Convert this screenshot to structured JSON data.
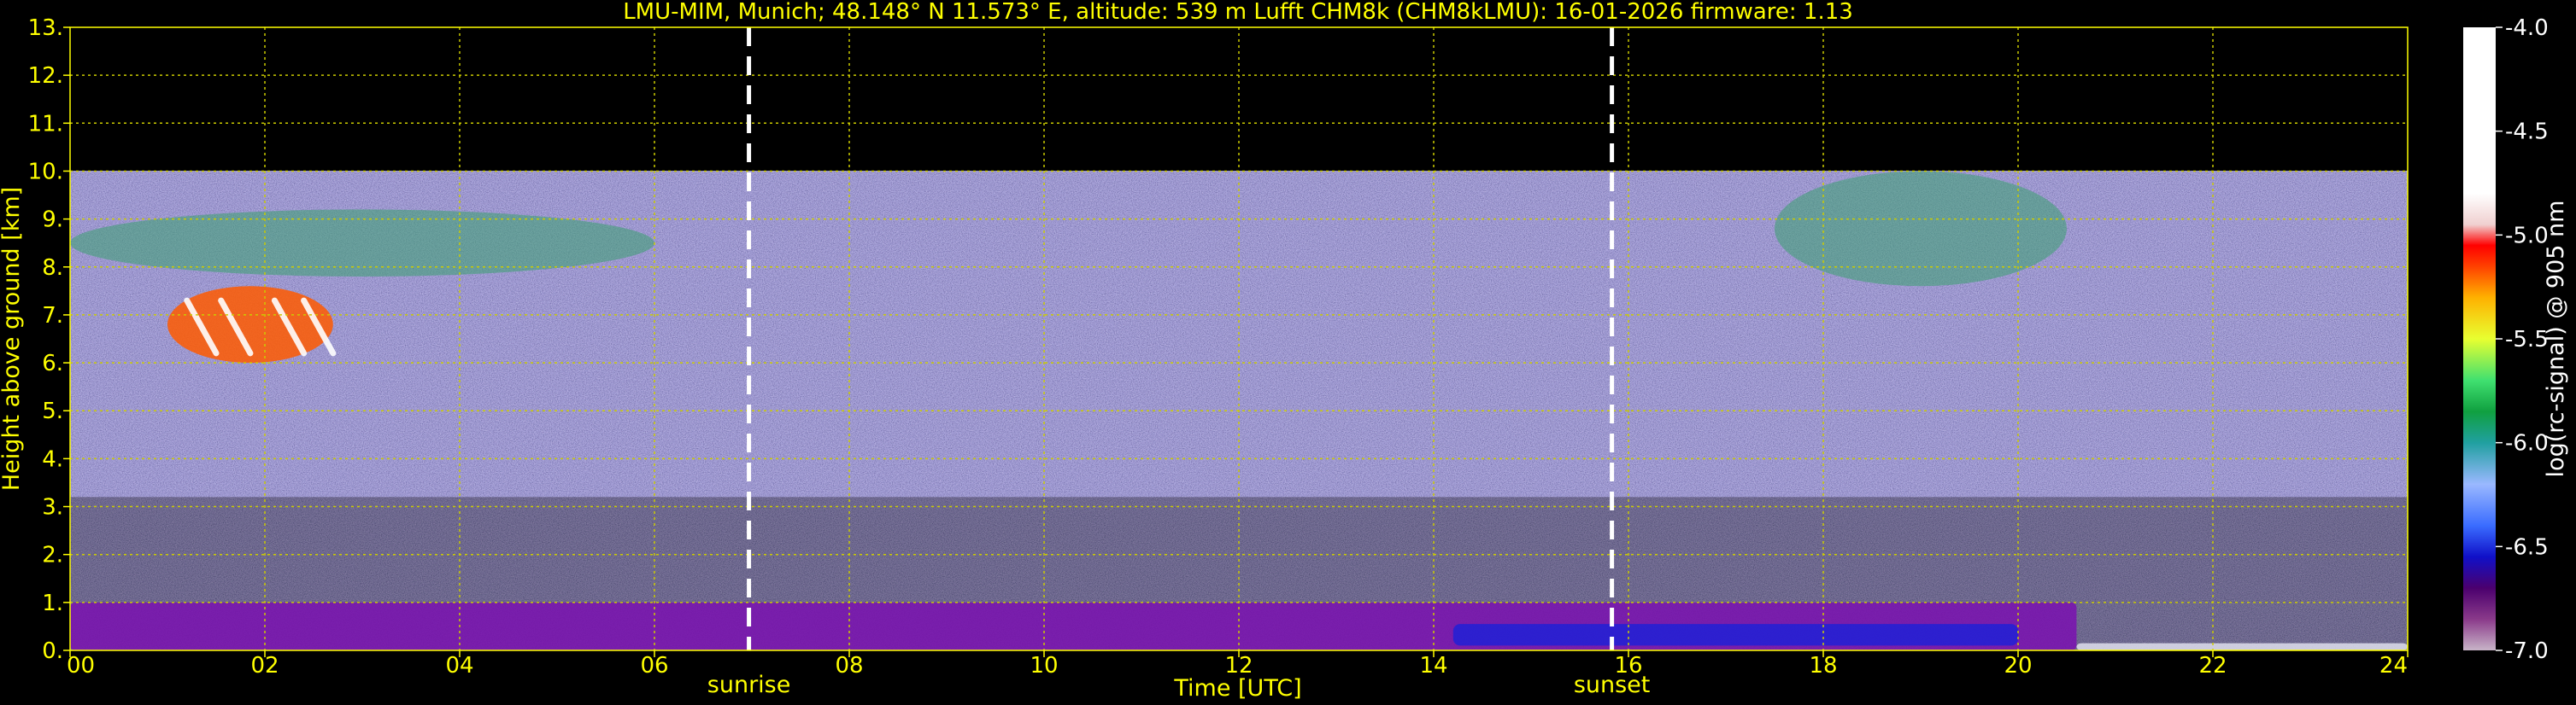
{
  "chart_data": {
    "type": "heatmap",
    "title": "LMU-MIM, Munich; 48.148° N 11.573° E, altitude: 539 m    Lufft CHM8k (CHM8kLMU): 16-01-2026    firmware: 1.13",
    "xlabel": "Time [UTC]",
    "ylabel": "Height above ground [km]",
    "colorbar_label": "log(rc-signal) @ 905 nm",
    "xlim": [
      0,
      24
    ],
    "ylim": [
      0,
      13
    ],
    "x_ticks": [
      "00",
      "02",
      "04",
      "06",
      "08",
      "10",
      "12",
      "14",
      "16",
      "18",
      "20",
      "22",
      "24"
    ],
    "y_ticks": [
      "0.",
      "1.",
      "2.",
      "3.",
      "4.",
      "5.",
      "6.",
      "7.",
      "8.",
      "9.",
      "10.",
      "11.",
      "12.",
      "13."
    ],
    "colorbar_range": [
      -7.0,
      -4.0
    ],
    "colorbar_ticks": [
      "-7.0",
      "-6.5",
      "-6.0",
      "-5.5",
      "-5.0",
      "-4.5",
      "-4.0"
    ],
    "colorbar_stops": [
      {
        "v": -7.0,
        "color": "#c8b4c8"
      },
      {
        "v": -6.85,
        "color": "#8a3a8a"
      },
      {
        "v": -6.7,
        "color": "#4b006e"
      },
      {
        "v": -6.55,
        "color": "#1010c8"
      },
      {
        "v": -6.4,
        "color": "#3a6cff"
      },
      {
        "v": -6.2,
        "color": "#9ab8ff"
      },
      {
        "v": -6.0,
        "color": "#20a0a0"
      },
      {
        "v": -5.85,
        "color": "#10a040"
      },
      {
        "v": -5.7,
        "color": "#40e070"
      },
      {
        "v": -5.5,
        "color": "#e8ff30"
      },
      {
        "v": -5.3,
        "color": "#ffb000"
      },
      {
        "v": -5.15,
        "color": "#ff4000"
      },
      {
        "v": -5.05,
        "color": "#ff0000"
      },
      {
        "v": -4.95,
        "color": "#f0d0d0"
      },
      {
        "v": -4.8,
        "color": "#ffffff"
      },
      {
        "v": -4.0,
        "color": "#ffffff"
      }
    ],
    "markers": [
      {
        "name": "sunrise",
        "x": 6.97
      },
      {
        "name": "sunset",
        "x": 15.83
      }
    ],
    "grid": true,
    "signal_top_km": 10,
    "features": [
      {
        "kind": "high cloud band",
        "x": [
          0.0,
          6.0
        ],
        "y": [
          7.8,
          9.2
        ]
      },
      {
        "kind": "cirrus with strong returns",
        "x": [
          1.0,
          2.7
        ],
        "y": [
          6.0,
          7.6
        ]
      },
      {
        "kind": "high cloud band",
        "x": [
          17.5,
          20.5
        ],
        "y": [
          7.6,
          10.0
        ]
      },
      {
        "kind": "boundary layer aerosol",
        "x": [
          0.0,
          20.6
        ],
        "y": [
          0.0,
          1.0
        ]
      },
      {
        "kind": "surface layer",
        "x": [
          20.6,
          24.0
        ],
        "y": [
          0.0,
          0.15
        ]
      }
    ]
  },
  "colors": {
    "background": "#000000",
    "text": "#ffff00",
    "grid": "#cccc00",
    "noise_base": "#2b2b70"
  }
}
